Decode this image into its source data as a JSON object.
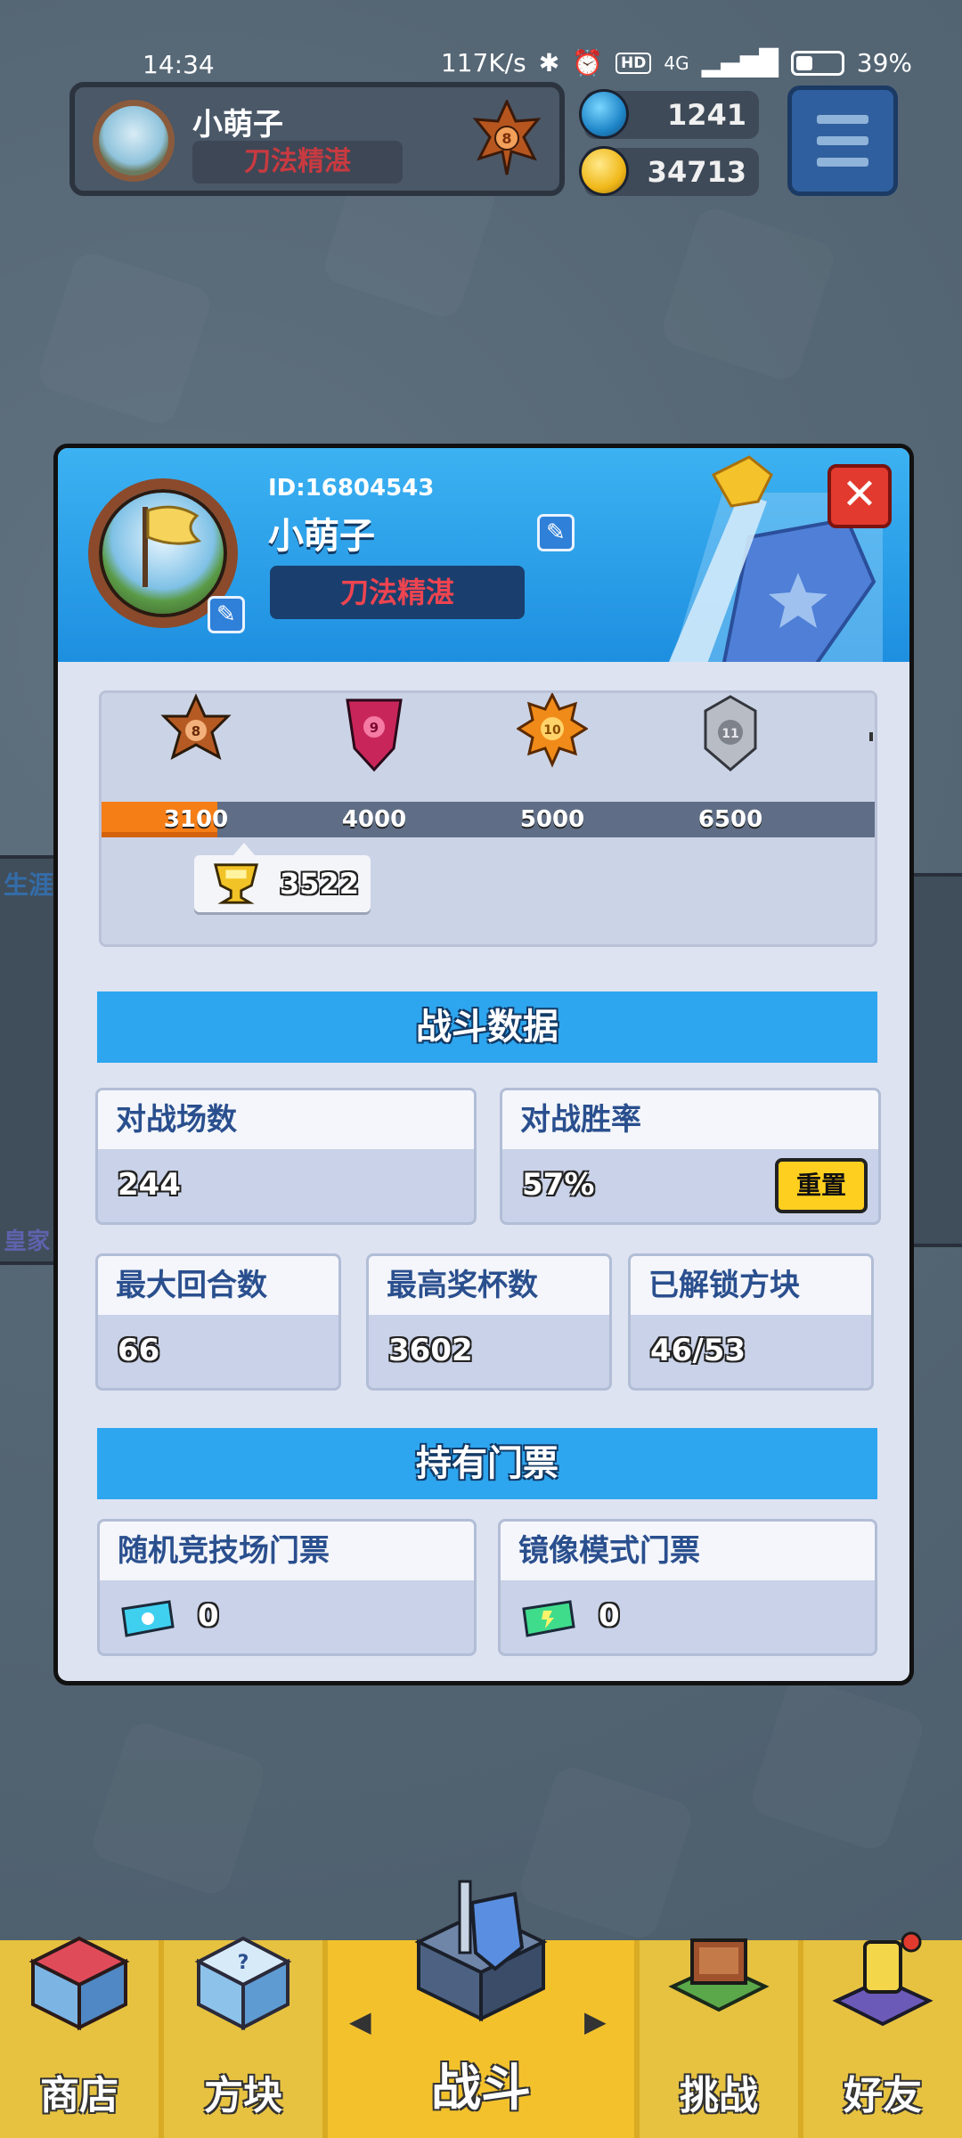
{
  "status_bar": {
    "time": "14:34",
    "net_speed": "117K/s",
    "hd": "HD",
    "signal": "4G",
    "battery": "39%"
  },
  "hud": {
    "player_name": "小萌子",
    "player_title": "刀法精湛",
    "rank_level": "8",
    "gems": "1241",
    "coins": "34713",
    "menu_icon": "hamburger-menu-icon"
  },
  "profile": {
    "id_text": "ID:16804543",
    "name": "小萌子",
    "title": "刀法精湛",
    "avatar_icon": "flag-avatar-icon",
    "edit_icon": "pencil-icon",
    "close_icon": "close-icon"
  },
  "rank_track": {
    "badges": [
      {
        "level": "8",
        "threshold": "3100",
        "color": "#b65a23"
      },
      {
        "level": "9",
        "threshold": "4000",
        "color": "#c8265a"
      },
      {
        "level": "10",
        "threshold": "5000",
        "color": "#f08a18"
      },
      {
        "level": "11",
        "threshold": "6500",
        "color": "#b8bcc4"
      }
    ],
    "progress_fraction": 0.15,
    "current_trophies": "3522"
  },
  "battle_data": {
    "header": "战斗数据",
    "matches_label": "对战场数",
    "matches_value": "244",
    "winrate_label": "对战胜率",
    "winrate_value": "57%",
    "reset_label": "重置",
    "max_rounds_label": "最大回合数",
    "max_rounds_value": "66",
    "max_trophies_label": "最高奖杯数",
    "max_trophies_value": "3602",
    "unlocked_blocks_label": "已解锁方块",
    "unlocked_blocks_value": "46/53"
  },
  "tickets": {
    "header": "持有门票",
    "random_arena_label": "随机竞技场门票",
    "random_arena_value": "0",
    "mirror_mode_label": "镜像模式门票",
    "mirror_mode_value": "0"
  },
  "bottom_nav": {
    "shop": "商店",
    "blocks": "方块",
    "battle": "战斗",
    "challenge": "挑战",
    "friends": "好友"
  },
  "background": {
    "left_tag_1": "生涯",
    "left_tag_2": "皇家"
  }
}
